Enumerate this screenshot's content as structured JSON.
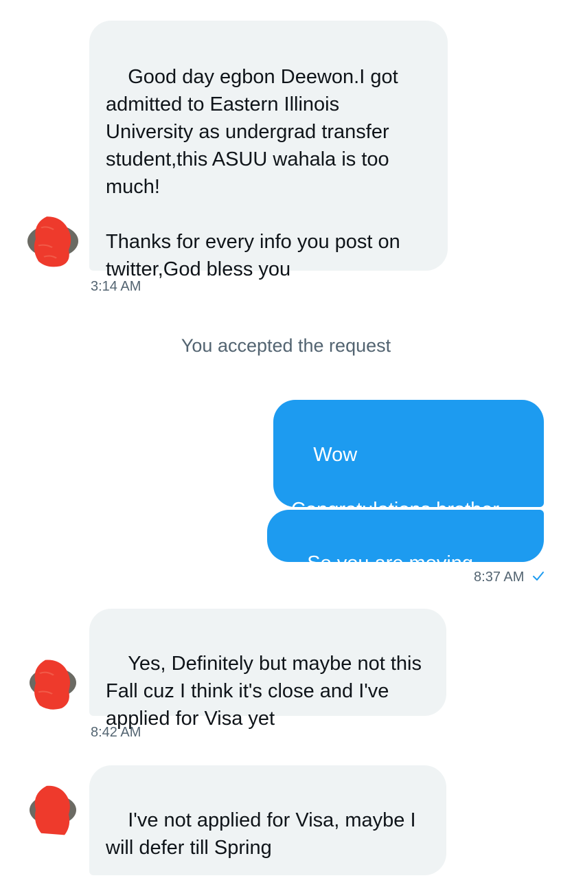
{
  "messages": [
    {
      "direction": "in",
      "text": "Good day egbon Deewon.I got admitted to Eastern Illinois University as undergrad transfer student,this ASUU wahala is too much!\n\nThanks for every info you post on twitter,God bless you",
      "time": "3:14 AM"
    },
    {
      "system": "You accepted the request"
    },
    {
      "direction": "out",
      "text": "Wow\n\nCongratulations brother"
    },
    {
      "direction": "out",
      "text": "So you are moving right?",
      "time": "8:37 AM",
      "status": "seen"
    },
    {
      "direction": "in",
      "text": "Yes, Definitely but maybe not this Fall cuz I think it's close and I've applied for Visa yet",
      "time": "8:42 AM"
    },
    {
      "direction": "in",
      "text": "I've not applied for Visa, maybe I will defer till Spring"
    }
  ],
  "colors": {
    "incoming_bubble": "#eff3f4",
    "outgoing_bubble": "#1d9bf0",
    "timestamp": "#536471",
    "check": "#1d9bf0",
    "avatar_redaction": "#ee3a2c"
  },
  "icons": {
    "read_receipt": "check-icon",
    "avatar": "redacted-avatar"
  }
}
